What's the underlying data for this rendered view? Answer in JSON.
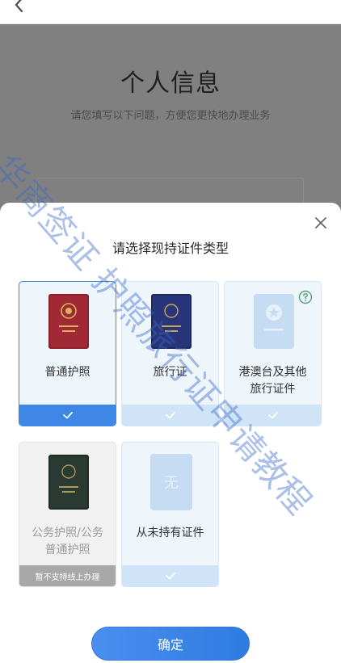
{
  "page": {
    "title": "个人信息",
    "subtitle": "请您填写以下问题，方便您更快地办理业务"
  },
  "sheet": {
    "title": "请选择现持证件类型",
    "cards": [
      {
        "label": "普通护照",
        "selected": true,
        "disabled": false,
        "footer": "check-icon"
      },
      {
        "label": "旅行证",
        "selected": false,
        "disabled": false,
        "footer": "check-icon"
      },
      {
        "label_line1": "港澳台及其他",
        "label_line2": "旅行证件",
        "selected": false,
        "disabled": false,
        "footer": "check-icon",
        "icon": "help-circle-icon"
      },
      {
        "label_line1": "公务护照/公务",
        "label_line2": "普通护照",
        "selected": false,
        "disabled": true,
        "footer_text": "暂不支持线上办理"
      },
      {
        "label": "从未持有证件",
        "placeholder_glyph": "无",
        "selected": false,
        "disabled": false,
        "footer": "check-icon"
      }
    ],
    "confirm_label": "确定"
  },
  "watermark": {
    "text": "华商签证 护照旅行证申请教程"
  },
  "colors": {
    "accent": "#3e87e6",
    "card_bg": "#eef5fb",
    "overlay": "#7d7d7d",
    "watermark": "#3667c6"
  }
}
